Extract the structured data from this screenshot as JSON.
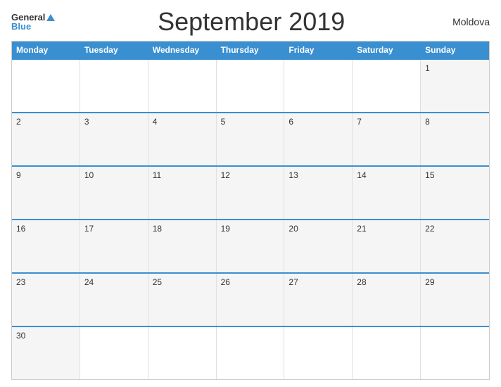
{
  "header": {
    "logo_general": "General",
    "logo_blue": "Blue",
    "title": "September 2019",
    "country": "Moldova"
  },
  "calendar": {
    "weekdays": [
      "Monday",
      "Tuesday",
      "Wednesday",
      "Thursday",
      "Friday",
      "Saturday",
      "Sunday"
    ],
    "rows": [
      [
        {
          "day": "",
          "empty": true
        },
        {
          "day": "",
          "empty": true
        },
        {
          "day": "",
          "empty": true
        },
        {
          "day": "",
          "empty": true
        },
        {
          "day": "",
          "empty": true
        },
        {
          "day": "",
          "empty": true
        },
        {
          "day": "1"
        }
      ],
      [
        {
          "day": "2"
        },
        {
          "day": "3"
        },
        {
          "day": "4"
        },
        {
          "day": "5"
        },
        {
          "day": "6"
        },
        {
          "day": "7"
        },
        {
          "day": "8"
        }
      ],
      [
        {
          "day": "9"
        },
        {
          "day": "10"
        },
        {
          "day": "11"
        },
        {
          "day": "12"
        },
        {
          "day": "13"
        },
        {
          "day": "14"
        },
        {
          "day": "15"
        }
      ],
      [
        {
          "day": "16"
        },
        {
          "day": "17"
        },
        {
          "day": "18"
        },
        {
          "day": "19"
        },
        {
          "day": "20"
        },
        {
          "day": "21"
        },
        {
          "day": "22"
        }
      ],
      [
        {
          "day": "23"
        },
        {
          "day": "24"
        },
        {
          "day": "25"
        },
        {
          "day": "26"
        },
        {
          "day": "27"
        },
        {
          "day": "28"
        },
        {
          "day": "29"
        }
      ],
      [
        {
          "day": "30"
        },
        {
          "day": "",
          "empty": true
        },
        {
          "day": "",
          "empty": true
        },
        {
          "day": "",
          "empty": true
        },
        {
          "day": "",
          "empty": true
        },
        {
          "day": "",
          "empty": true
        },
        {
          "day": "",
          "empty": true
        }
      ]
    ]
  }
}
